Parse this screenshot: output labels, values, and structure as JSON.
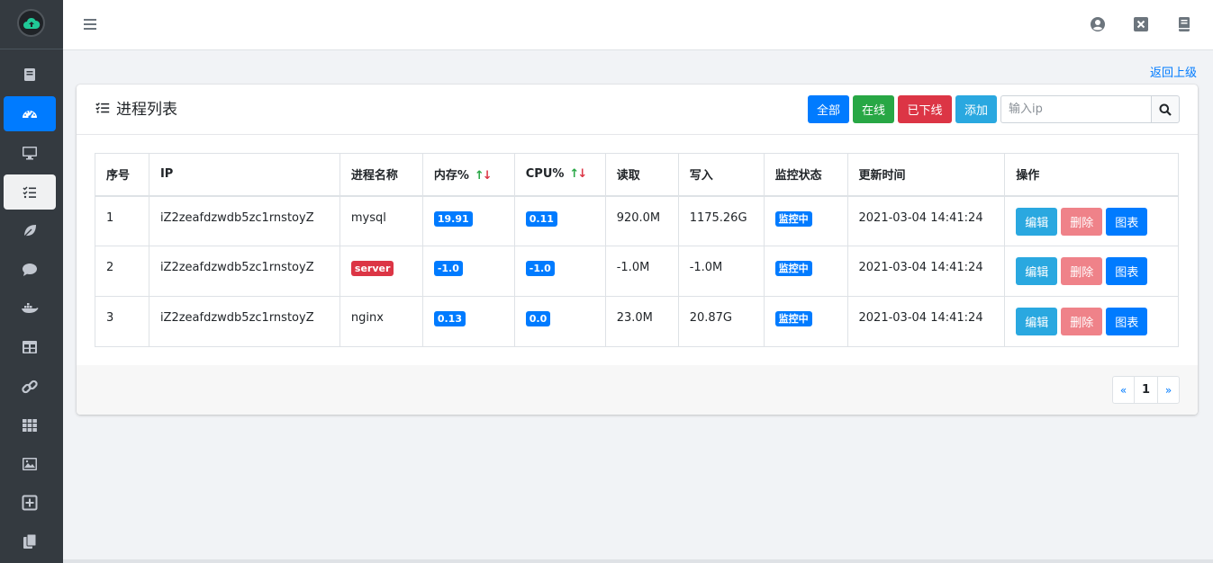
{
  "sidebar": {
    "items": [
      {
        "icon": "book-icon",
        "active": false
      },
      {
        "icon": "dashboard-icon",
        "active": true
      },
      {
        "icon": "monitor-icon",
        "active": false
      },
      {
        "icon": "tasks-icon",
        "active": false,
        "hover": true
      },
      {
        "icon": "leaf-icon",
        "active": false
      },
      {
        "icon": "comment-icon",
        "active": false
      },
      {
        "icon": "docker-icon",
        "active": false
      },
      {
        "icon": "table-icon",
        "active": false
      },
      {
        "icon": "link-icon",
        "active": false
      },
      {
        "icon": "grid-icon",
        "active": false
      },
      {
        "icon": "image-icon",
        "active": false
      },
      {
        "icon": "plus-square-icon",
        "active": false
      },
      {
        "icon": "copy-icon",
        "active": false
      }
    ]
  },
  "header": {
    "back_link": "返回上级"
  },
  "card": {
    "title": "进程列表",
    "filters": {
      "all": "全部",
      "online": "在线",
      "offline": "已下线",
      "add": "添加"
    },
    "search": {
      "placeholder": "输入ip",
      "value": ""
    }
  },
  "table": {
    "columns": [
      "序号",
      "IP",
      "进程名称",
      "内存%",
      "CPU%",
      "读取",
      "写入",
      "监控状态",
      "更新时间",
      "操作"
    ],
    "sort_arrows": "↑↓",
    "rows": [
      {
        "no": "1",
        "ip": "iZ2zeafdzwdb5zc1rnstoyZ",
        "name": "mysql",
        "name_badge": false,
        "mem": "19.91",
        "cpu": "0.11",
        "read": "920.0M",
        "write": "1175.26G",
        "status": "监控中",
        "time": "2021-03-04 14:41:24"
      },
      {
        "no": "2",
        "ip": "iZ2zeafdzwdb5zc1rnstoyZ",
        "name": "server",
        "name_badge": true,
        "mem": "-1.0",
        "cpu": "-1.0",
        "read": "-1.0M",
        "write": "-1.0M",
        "status": "监控中",
        "time": "2021-03-04 14:41:24"
      },
      {
        "no": "3",
        "ip": "iZ2zeafdzwdb5zc1rnstoyZ",
        "name": "nginx",
        "name_badge": false,
        "mem": "0.13",
        "cpu": "0.0",
        "read": "23.0M",
        "write": "20.87G",
        "status": "监控中",
        "time": "2021-03-04 14:41:24"
      }
    ],
    "actions": {
      "edit": "编辑",
      "delete": "删除",
      "chart": "图表"
    }
  },
  "pagination": {
    "prev": "«",
    "current": "1",
    "next": "»"
  },
  "colors": {
    "primary": "#007bff",
    "success": "#28a745",
    "danger": "#dc3545",
    "info": "#2aa8e0",
    "sidebar": "#343a40"
  }
}
